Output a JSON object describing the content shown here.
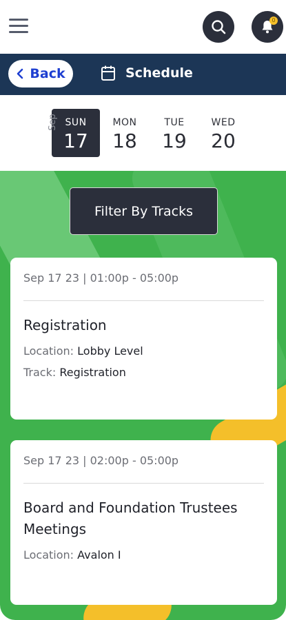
{
  "header": {
    "menu_icon": "hamburger-icon",
    "search_icon": "search-icon",
    "bell_icon": "bell-icon",
    "notification_count": "0"
  },
  "nav": {
    "back_label": "Back",
    "title": "Schedule",
    "title_icon": "calendar-icon"
  },
  "dates": {
    "month": "Sep",
    "days": [
      {
        "name": "SUN",
        "num": "17"
      },
      {
        "name": "MON",
        "num": "18"
      },
      {
        "name": "TUE",
        "num": "19"
      },
      {
        "name": "WED",
        "num": "20"
      }
    ],
    "selected_index": 0
  },
  "filter": {
    "label": "Filter By Tracks"
  },
  "sessions": [
    {
      "time": "Sep 17 23 | 01:00p - 05:00p",
      "title": "Registration",
      "location_label": "Location:",
      "location": "Lobby Level",
      "track_label": "Track:",
      "track": "Registration"
    },
    {
      "time": "Sep 17 23 | 02:00p - 05:00p",
      "title": "Board and Foundation Trustees Meetings",
      "location_label": "Location:",
      "location": "Avalon I"
    }
  ],
  "colors": {
    "background_green": "#3fb24d",
    "accent_yellow": "#f4bf2a",
    "nav_navy": "#1c3656",
    "dark_button": "#2b2f3b",
    "back_blue": "#1e3fd1"
  }
}
